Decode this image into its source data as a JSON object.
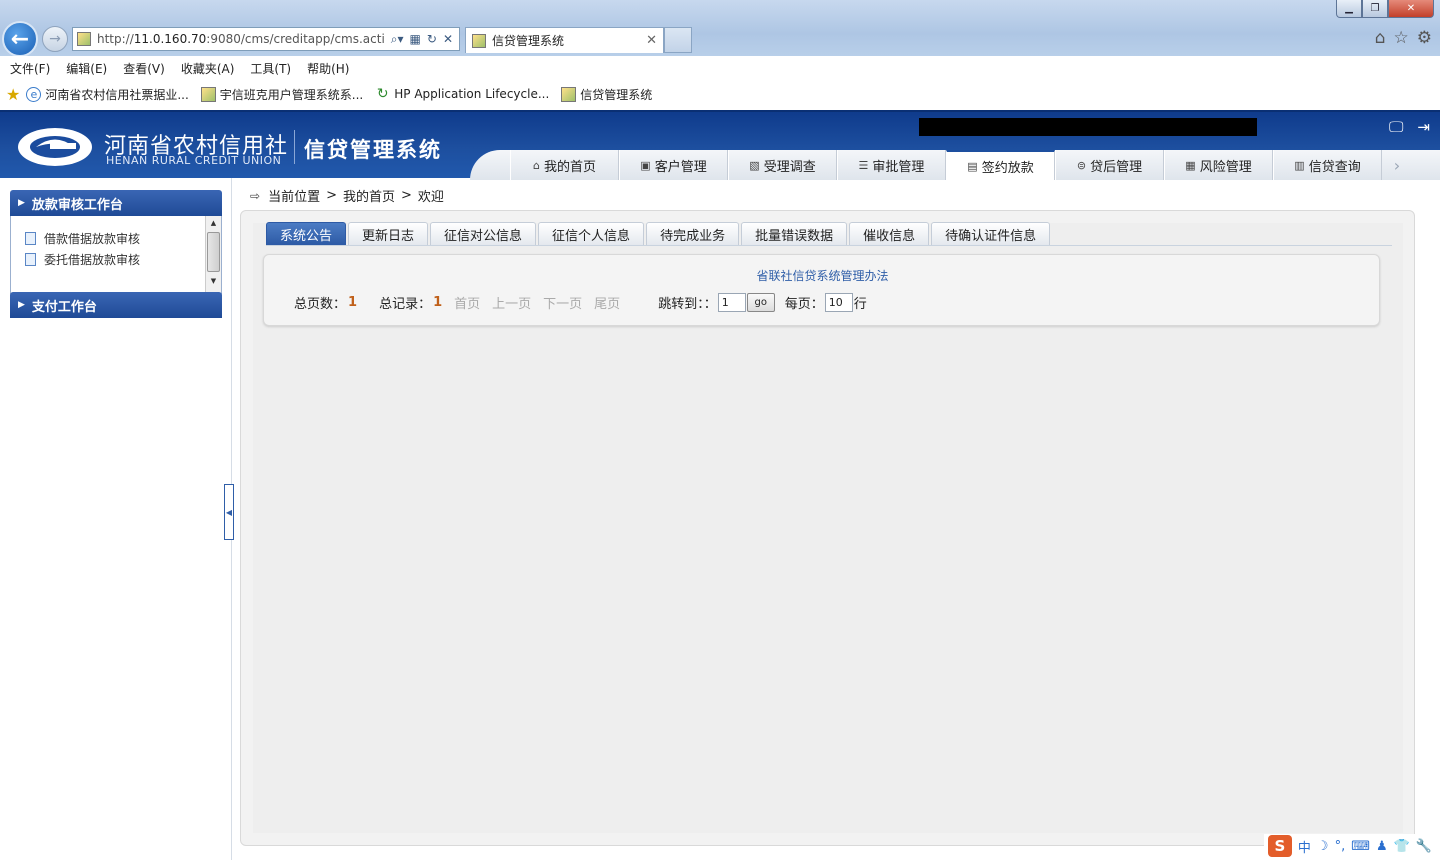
{
  "browser": {
    "url_prefix": "http://",
    "url_host": "11.0.160.70",
    "url_rest": ":9080/cms/creditapp/cms.actic",
    "tab_title": "信贷管理系统",
    "menu": [
      "文件(F)",
      "编辑(E)",
      "查看(V)",
      "收藏夹(A)",
      "工具(T)",
      "帮助(H)"
    ],
    "favorites": [
      "河南省农村信用社票据业...",
      "宇信班克用户管理系统系...",
      "HP Application Lifecycle...",
      "信贷管理系统"
    ]
  },
  "header": {
    "org_cn": "河南省农村信用社",
    "org_en": "HENAN RURAL CREDIT UNION",
    "system_name": "信贷管理系统"
  },
  "main_nav": {
    "items": [
      "我的首页",
      "客户管理",
      "受理调查",
      "审批管理",
      "签约放款",
      "贷后管理",
      "风险管理",
      "信贷查询"
    ],
    "active": "签约放款"
  },
  "sidebar": {
    "panel1_title": "放款审核工作台",
    "panel1_links": [
      "借款借据放款审核",
      "委托借据放款审核"
    ],
    "panel2_title": "支付工作台"
  },
  "breadcrumb": {
    "label": "当前位置",
    "sep": ">",
    "home": "我的首页",
    "current": "欢迎"
  },
  "sub_tabs": {
    "items": [
      "系统公告",
      "更新日志",
      "征信对公信息",
      "征信个人信息",
      "待完成业务",
      "批量错误数据",
      "催收信息",
      "待确认证件信息"
    ],
    "active": "系统公告"
  },
  "notice": {
    "title": "省联社信贷系统管理办法"
  },
  "pager": {
    "total_pages_label": "总页数：",
    "total_pages": "1",
    "total_records_label": "总记录：",
    "total_records": "1",
    "first": "首页",
    "prev": "上一页",
    "next": "下一页",
    "last": "尾页",
    "jump_label": "跳转到：：",
    "jump_value": "1",
    "go": "go",
    "per_page_label": "每页：",
    "per_page_value": "10",
    "rows_suffix": "行"
  },
  "ime": {
    "mode": "中"
  }
}
